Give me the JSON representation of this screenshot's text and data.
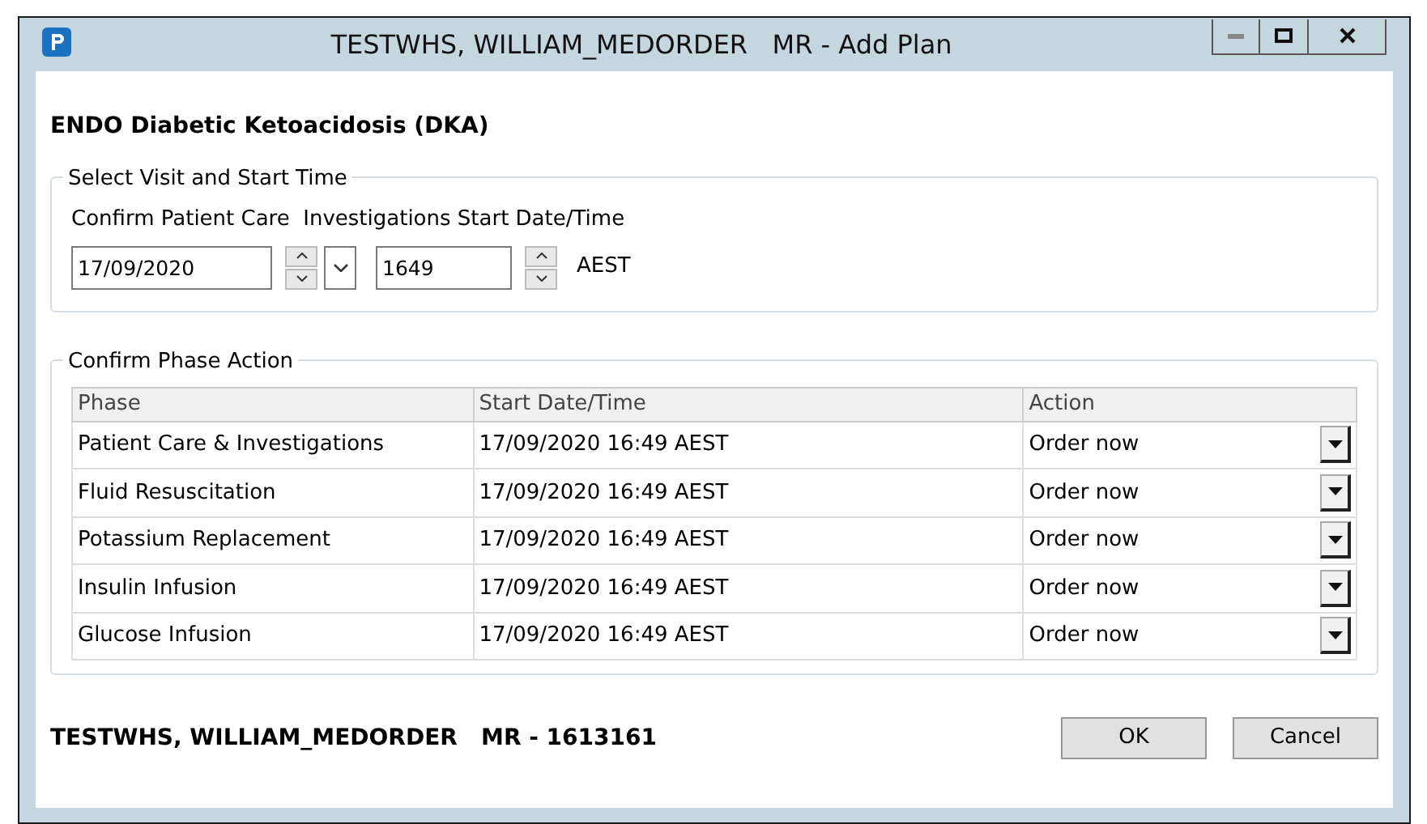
{
  "window": {
    "title": "TESTWHS, WILLIAM_MEDORDER   MR - Add Plan"
  },
  "plan_title": "ENDO Diabetic Ketoacidosis (DKA)",
  "visit_group": {
    "legend": "Select Visit and Start Time",
    "label": "Confirm Patient Care  Investigations Start Date/Time",
    "date": "17/09/2020",
    "time": "1649",
    "timezone": "AEST"
  },
  "phase_group": {
    "legend": "Confirm Phase Action",
    "table": {
      "columns": [
        "Phase",
        "Start Date/Time",
        "Action"
      ],
      "rows": [
        [
          "Patient Care & Investigations",
          "17/09/2020 16:49 AEST",
          "Order now"
        ],
        [
          "Fluid Resuscitation",
          "17/09/2020 16:49 AEST",
          "Order now"
        ],
        [
          "Potassium Replacement",
          "17/09/2020 16:49 AEST",
          "Order now"
        ],
        [
          "Insulin Infusion",
          "17/09/2020 16:49 AEST",
          "Order now"
        ],
        [
          "Glucose Infusion",
          "17/09/2020 16:49 AEST",
          "Order now"
        ]
      ]
    }
  },
  "footer": {
    "patient": "TESTWHS, WILLIAM_MEDORDER   MR - 1613161",
    "buttons": [
      "OK",
      "Cancel"
    ]
  }
}
